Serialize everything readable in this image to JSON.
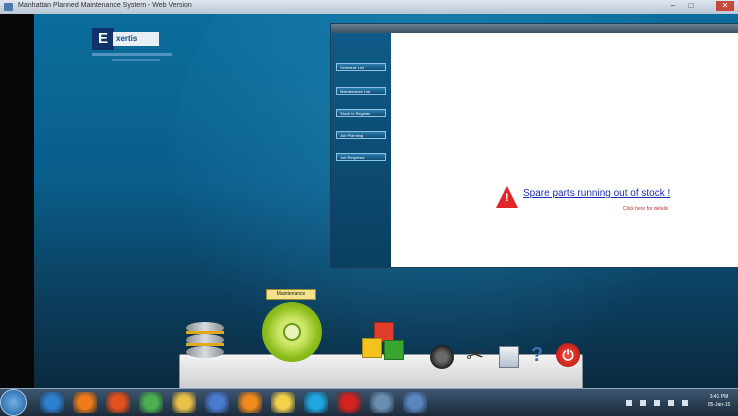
{
  "window": {
    "title": "Manhattan Planned Maintenance System - Web Version",
    "minimize_label": "–",
    "maximize_label": "□",
    "close_label": "✕"
  },
  "logo": {
    "mark": "E",
    "word": "xertis"
  },
  "panel": {
    "menu": [
      {
        "label": "Schedule List"
      },
      {
        "label": "Maintenance List"
      },
      {
        "label": "Stock In Register"
      },
      {
        "label": "Job Planning"
      },
      {
        "label": "Job Requests"
      }
    ],
    "alert": {
      "icon": "warning-icon",
      "message": "Spare parts running out of stock !",
      "sub": "Click here for details"
    }
  },
  "dock": {
    "tooltip": "Maintenance",
    "icons": [
      {
        "name": "database-icon"
      },
      {
        "name": "gear-icon"
      },
      {
        "name": "cubes-icon"
      },
      {
        "name": "camera-icon"
      },
      {
        "name": "tools-icon"
      },
      {
        "name": "calculator-icon"
      },
      {
        "name": "help-icon"
      },
      {
        "name": "power-icon"
      }
    ]
  },
  "taskbar": {
    "items": [
      {
        "name": "start-button-icon",
        "color": "#2a6bb0"
      },
      {
        "name": "internet-explorer-icon",
        "color": "#2d7fd0"
      },
      {
        "name": "media-player-icon",
        "color": "#f07b18"
      },
      {
        "name": "firefox-icon",
        "color": "#e4501c"
      },
      {
        "name": "chrome-icon",
        "color": "#4caf50"
      },
      {
        "name": "explorer-folder-icon",
        "color": "#e8c04a"
      },
      {
        "name": "network-icon",
        "color": "#4a7bd0"
      },
      {
        "name": "vlc-icon",
        "color": "#f28a1e"
      },
      {
        "name": "notes-icon",
        "color": "#f3d24a"
      },
      {
        "name": "skype-icon",
        "color": "#1ea7e1"
      },
      {
        "name": "acrobat-icon",
        "color": "#d4231f"
      },
      {
        "name": "remote-desktop-icon",
        "color": "#6a8fb3"
      },
      {
        "name": "app-window-icon",
        "color": "#5b86c0"
      }
    ],
    "clock_time": "3:41 PM",
    "clock_date": "05-Jan-15"
  }
}
